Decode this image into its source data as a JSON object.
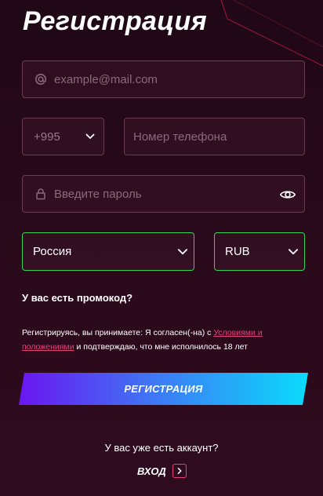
{
  "header": {
    "title": "Регистрация"
  },
  "form": {
    "email": {
      "placeholder": "example@mail.com",
      "icon": "at-icon"
    },
    "phone_code": {
      "value": "+995",
      "icon": "chevron-down-icon"
    },
    "phone": {
      "placeholder": "Номер телефона"
    },
    "password": {
      "placeholder": "Введите пароль",
      "lock_icon": "lock-icon",
      "toggle_icon": "eye-icon"
    },
    "country": {
      "value": "Россия",
      "icon": "chevron-down-icon"
    },
    "currency": {
      "value": "RUB",
      "icon": "chevron-down-icon"
    },
    "promo_label": "У вас есть промокод?",
    "terms": {
      "prefix": "Регистрируясь, вы принимаете: Я согласен(-на) с ",
      "link": "Условиями и положениями",
      "suffix": " и подтверждаю, что мне исполнилось 18 лет"
    },
    "submit_label": "РЕГИСТРАЦИЯ"
  },
  "footer": {
    "question": "У вас уже есть аккаунт?",
    "login_label": "ВХОД",
    "login_icon": "chevron-right-icon"
  },
  "colors": {
    "background": "#2a0a1b",
    "field_border": "#6c3d52",
    "valid_border": "#36d35a",
    "accent": "#e4407a",
    "button_gradient": [
      "#6a16f0",
      "#0bdcfc"
    ]
  }
}
